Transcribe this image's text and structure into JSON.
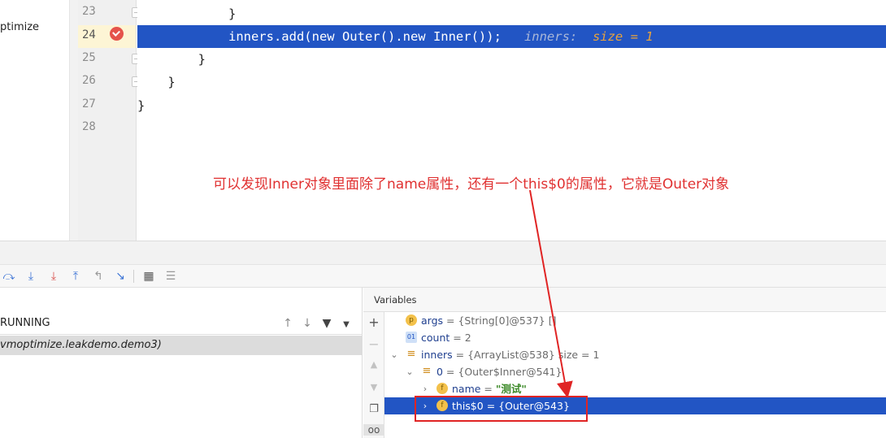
{
  "project": {
    "label": "ptimize"
  },
  "editor": {
    "lines": [
      {
        "number": "23",
        "code": "            }"
      },
      {
        "number": "24",
        "code": "            inners.add(new Outer().new Inner());",
        "inline_name": "inners:",
        "inline_value": "size = 1"
      },
      {
        "number": "25",
        "code": "        }"
      },
      {
        "number": "26",
        "code": "    }"
      },
      {
        "number": "27",
        "code": "}"
      },
      {
        "number": "28",
        "code": ""
      }
    ]
  },
  "annotation": {
    "text": "可以发现Inner对象里面除了name属性，还有一个this$0的属性，它就是Outer对象",
    "color": "#e03131"
  },
  "toolbar": {
    "icons": [
      "step-over-icon",
      "step-into-icon",
      "force-step-into-icon",
      "step-out-icon",
      "drop-frame-icon",
      "run-to-cursor-icon",
      "evaluate-icon",
      "trace-icon"
    ]
  },
  "frames": {
    "thread_label": "RUNNING",
    "frame_label": "vmoptimize.leakdemo.demo3)"
  },
  "variables": {
    "header": "Variables",
    "rows": [
      {
        "name": "args",
        "value": " = {String[0]@537} []"
      },
      {
        "name": "count",
        "value": " = 2"
      },
      {
        "name": "inners",
        "value": " = {ArrayList@538}  size = 1"
      },
      {
        "name": "0",
        "value": " = {Outer$Inner@541}"
      },
      {
        "name": "name",
        "eq": " = ",
        "value": "\"测试\""
      },
      {
        "name": "this$0",
        "value": " = {Outer@543}"
      }
    ]
  },
  "colors": {
    "selection": "#2255c4",
    "annotation": "#e03131",
    "highlight_box": "#e02424"
  }
}
